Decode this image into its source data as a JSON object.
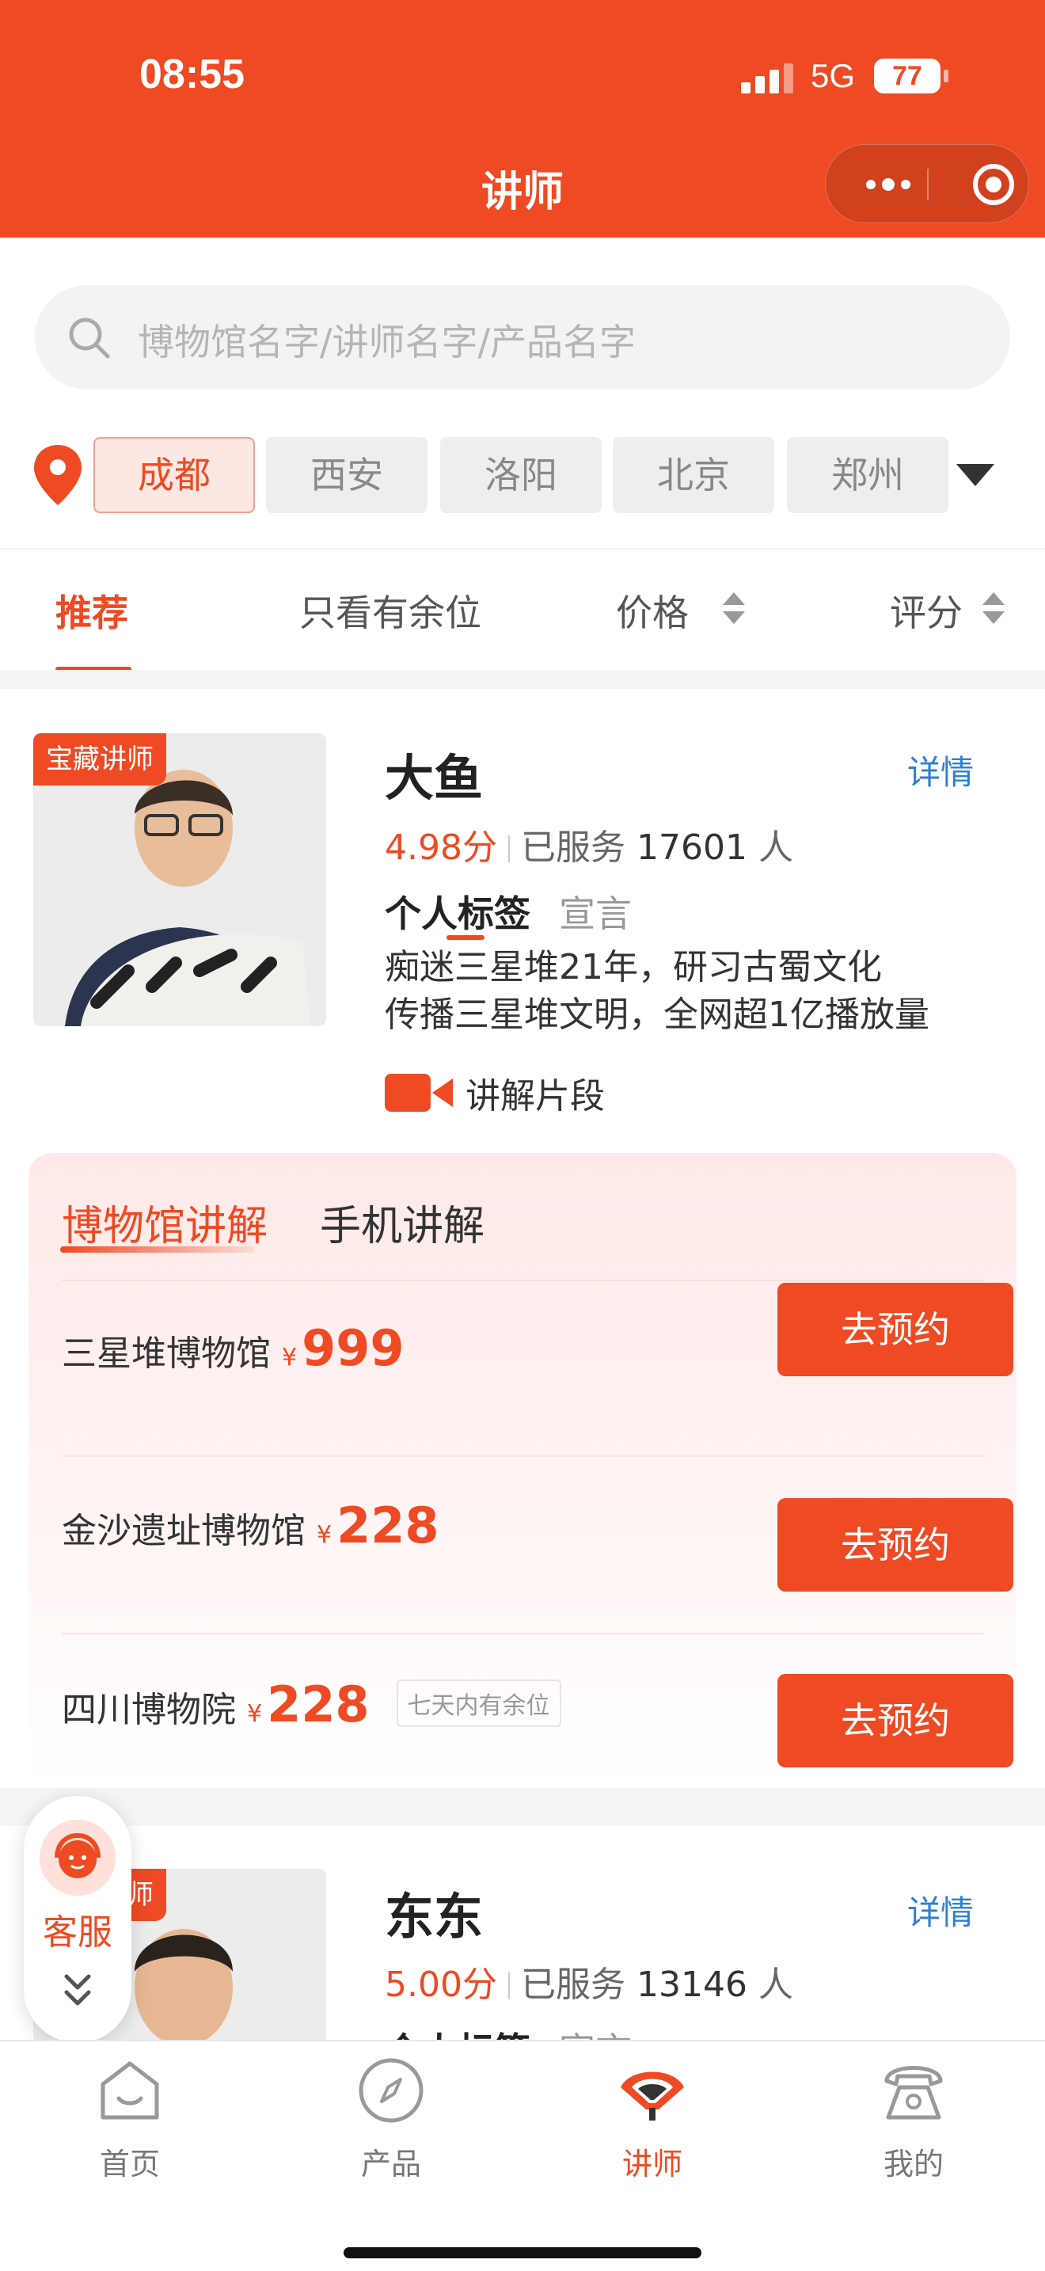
{
  "status_bar": {
    "time": "08:55",
    "network": "5G",
    "battery": "77"
  },
  "header": {
    "title": "讲师",
    "menu_icon": "more-dots-icon",
    "close_icon": "target-icon"
  },
  "search": {
    "placeholder": "博物馆名字/讲师名字/产品名字"
  },
  "cities": {
    "items": [
      "成都",
      "西安",
      "洛阳",
      "北京",
      "郑州"
    ],
    "selected": "成都"
  },
  "sort_tabs": {
    "items": [
      "推荐",
      "只看有余位",
      "价格",
      "评分"
    ],
    "active": "推荐"
  },
  "lecturers": [
    {
      "badge": "宝藏讲师",
      "name": "大鱼",
      "detail_label": "详情",
      "score": "4.98分",
      "served_label": "已服务",
      "served_count": "17601",
      "served_unit": "人",
      "tag_tab_active": "个人标签",
      "tag_tab_other": "宣言",
      "bio": [
        "痴迷三星堆21年，研习古蜀文化",
        "传播三星堆文明，全网超1亿播放量"
      ],
      "clip_label": "讲解片段",
      "booking_tabs": [
        "博物馆讲解",
        "手机讲解"
      ],
      "bookings": [
        {
          "museum": "三星堆博物馆",
          "currency": "¥",
          "price": "999",
          "note": "",
          "button": "去预约"
        },
        {
          "museum": "金沙遗址博物馆",
          "currency": "¥",
          "price": "228",
          "note": "",
          "button": "去预约"
        },
        {
          "museum": "四川博物院",
          "currency": "¥",
          "price": "228",
          "note": "七天内有余位",
          "button": "去预约"
        }
      ]
    },
    {
      "badge": "宝藏讲师",
      "name": "东东",
      "detail_label": "详情",
      "score": "5.00分",
      "served_label": "已服务",
      "served_count": "13146",
      "served_unit": "人",
      "tag_tab_active": "个人标签",
      "tag_tab_other": "宣言"
    }
  ],
  "service": {
    "label": "客服"
  },
  "tabbar": {
    "items": [
      {
        "label": "首页",
        "icon": "home-icon"
      },
      {
        "label": "产品",
        "icon": "compass-icon"
      },
      {
        "label": "讲师",
        "icon": "fan-icon"
      },
      {
        "label": "我的",
        "icon": "telephone-icon"
      }
    ],
    "active": "讲师"
  },
  "colors": {
    "brand": "#ee4a23",
    "link": "#2f7fd6"
  }
}
